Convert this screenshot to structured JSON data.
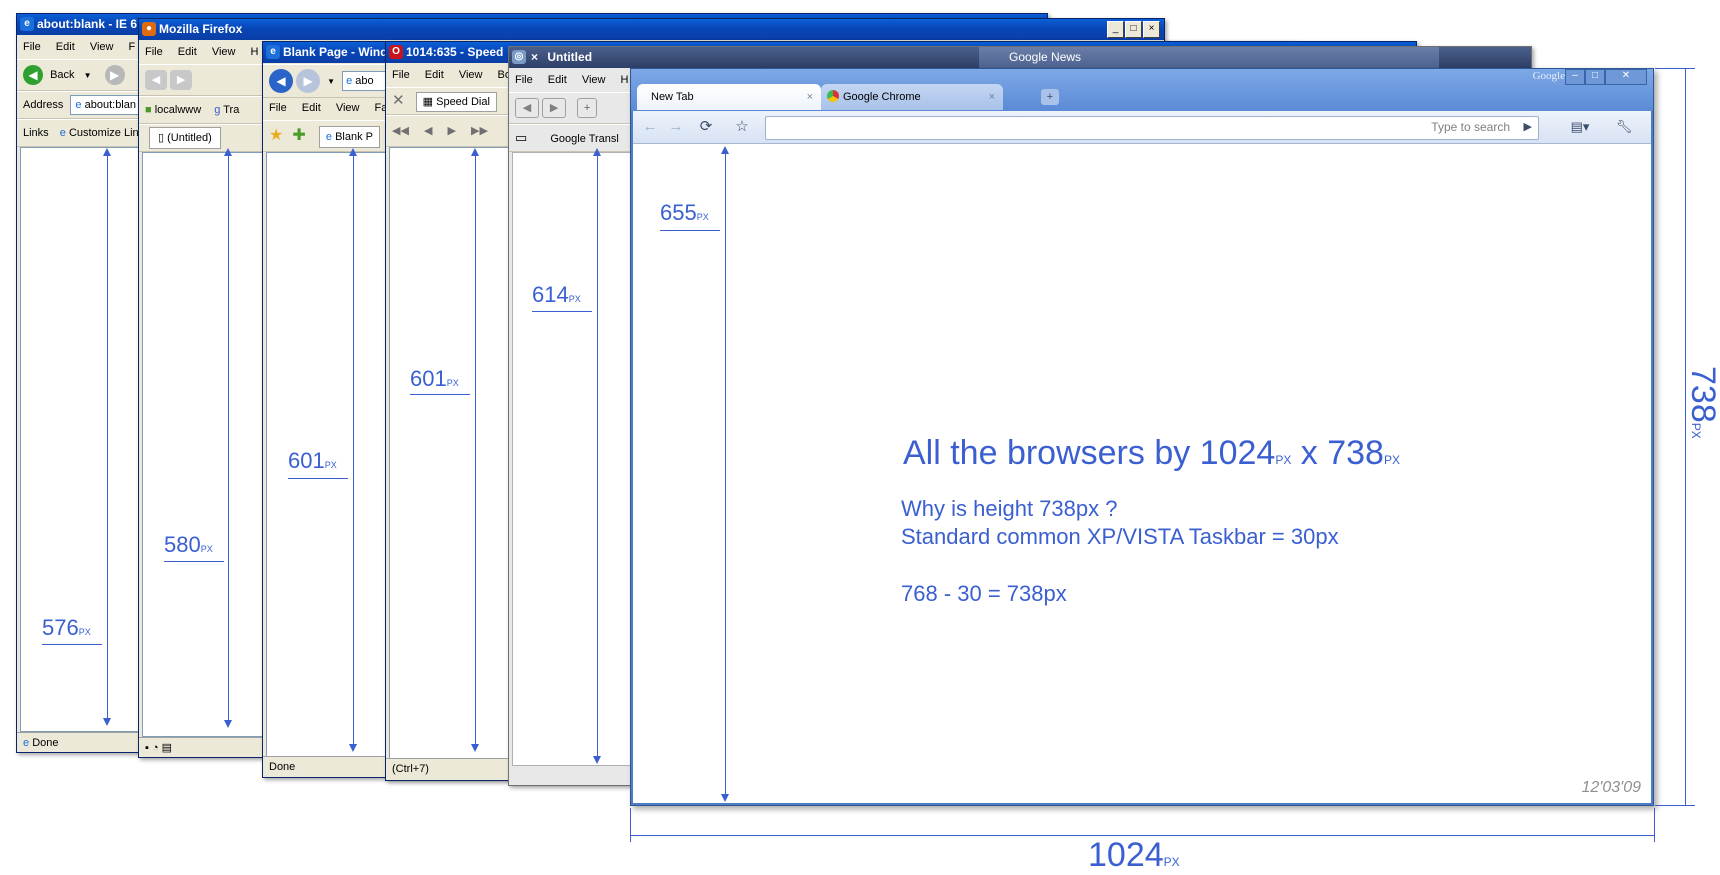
{
  "ie6": {
    "title": "about:blank - IE 6",
    "menu": [
      "File",
      "Edit",
      "View",
      "F"
    ],
    "back_label": "Back",
    "address_label": "Address",
    "address_value": "about:blan",
    "links_label": "Links",
    "links_item": "Customize Lin",
    "status": "Done",
    "measure_value": "576",
    "measure_unit": "PX"
  },
  "firefox": {
    "title": "Mozilla Firefox",
    "menu": [
      "File",
      "Edit",
      "View",
      "H"
    ],
    "bookmark1": "localwww",
    "bookmark2": "Tra",
    "tab_label": "(Untitled)",
    "measure_value": "580",
    "measure_unit": "PX"
  },
  "ie7": {
    "title": "Blank Page - Wind",
    "menu": [
      "File",
      "Edit",
      "View",
      "Fa"
    ],
    "address_value": "abo",
    "tab_label": "Blank P",
    "status": "Done",
    "measure_value": "601",
    "measure_unit": "PX"
  },
  "opera": {
    "title": "1014:635 - Speed",
    "menu": [
      "File",
      "Edit",
      "View",
      "Boo"
    ],
    "tab_label": "Speed Dial",
    "status": "(Ctrl+7)",
    "measure_value": "601",
    "measure_unit": "PX"
  },
  "safari": {
    "title": "Untitled",
    "tab2_title": "Google News",
    "menu": [
      "File",
      "Edit",
      "View",
      "H"
    ],
    "bookmark": "Google Transl",
    "measure_value": "614",
    "measure_unit": "PX"
  },
  "chrome": {
    "brand": "Google",
    "tab_new": "New Tab",
    "tab_google": "Google Chrome",
    "search_placeholder": "Type to search",
    "measure_value": "655",
    "measure_unit": "PX",
    "heading_a": "All the browsers by 1024",
    "heading_unit1": "PX",
    "heading_b": " x 738",
    "heading_unit2": "PX",
    "line1": "Why is height 738px ?",
    "line2": "Standard common XP/VISTA Taskbar = 30px",
    "line3": "768 - 30 = 738px",
    "date": "12'03'09"
  },
  "dimensions": {
    "width_value": "1024",
    "width_unit": "PX",
    "height_value": "738",
    "height_unit": "PX"
  }
}
